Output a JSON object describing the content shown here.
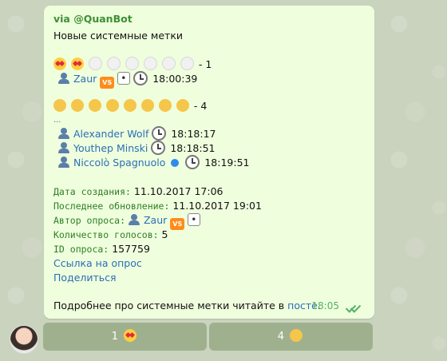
{
  "message": {
    "via": "via @QuanBot",
    "title": "Новые системные метки",
    "poll": {
      "line1_count": "- 1",
      "line1_user": "Zaur",
      "line1_time": "18:00:39",
      "line2_count": "- 4",
      "dots": "...",
      "users": [
        {
          "name": "Alexander Wolf",
          "time": "18:18:17"
        },
        {
          "name": "Youthep Minski",
          "time": "18:18:51"
        },
        {
          "name": "Niccolò Spagnuolo",
          "time": "18:19:51"
        }
      ]
    },
    "meta": {
      "created_label": "Дата создания:",
      "created_value": "11.10.2017 17:06",
      "updated_label": "Последнее обновление:",
      "updated_value": "11.10.2017 19:01",
      "author_label": "Автор опроса:",
      "author_value": "Zaur",
      "votes_label": "Количество голосов:",
      "votes_value": "5",
      "id_label": "ID опроса:",
      "id_value": "157759"
    },
    "links": {
      "poll": "Ссылка на опрос",
      "share": "Поделиться"
    },
    "footer_text": "Подробнее про системные метки читайте в",
    "footer_link": "посте",
    "footer_dot": ".",
    "time": "18:05"
  },
  "keyboard": [
    {
      "label": "1"
    },
    {
      "label": "4"
    }
  ],
  "icons": {
    "heart": "heart-eyes-icon",
    "empty": "white-circle-icon",
    "think": "thinking-face-icon",
    "user": "user-icon",
    "vs": "vs-icon",
    "die": "die-icon",
    "clock": "clock-icon",
    "apple": "apple-icon",
    "check": "double-check-icon"
  },
  "colors": {
    "bubble": "#effedd",
    "accent": "#3d8f34",
    "link": "#2a6fb6",
    "button": "#9fb08e"
  }
}
